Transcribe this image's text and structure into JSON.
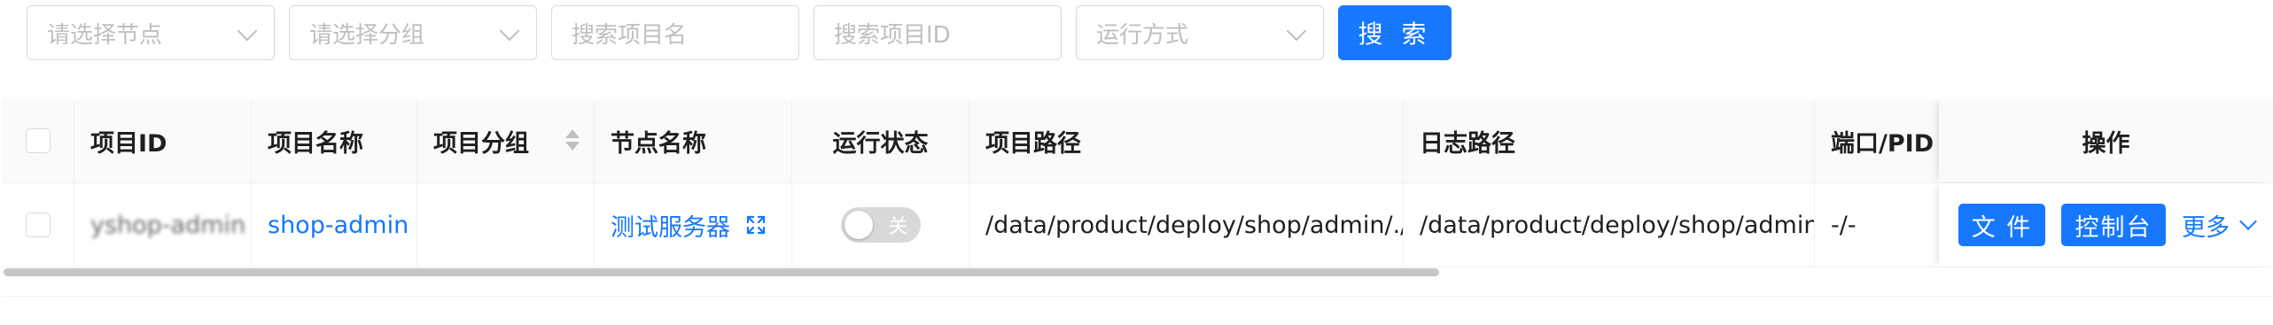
{
  "filters": {
    "node_select_placeholder": "请选择节点",
    "group_select_placeholder": "请选择分组",
    "project_name_placeholder": "搜索项目名",
    "project_id_placeholder": "搜索项目ID",
    "run_mode_placeholder": "运行方式",
    "search_button": "搜 索"
  },
  "table": {
    "headers": {
      "project_id": "项目ID",
      "project_name": "项目名称",
      "project_group": "项目分组",
      "node_name": "节点名称",
      "run_status": "运行状态",
      "project_path": "项目路径",
      "log_path": "日志路径",
      "port_pid": "端口/PID",
      "actions": "操作"
    },
    "rows": [
      {
        "project_id": "yshop-admin",
        "project_name": "shop-admin",
        "project_group": "",
        "node_name": "测试服务器",
        "run_status_label": "关",
        "run_status_on": false,
        "project_path": "/data/product/deploy/shop/admin/./",
        "log_path": "/data/product/deploy/shop/admin",
        "port_pid": "-/-",
        "actions": {
          "file_button": "文 件",
          "console_button": "控制台",
          "more_link": "更多"
        }
      }
    ]
  },
  "colors": {
    "primary": "#1677ff",
    "header_bg": "#fafafa",
    "border": "#f0f0f0",
    "placeholder": "#bfbfbf",
    "toggle_off": "#d9d9d9"
  }
}
